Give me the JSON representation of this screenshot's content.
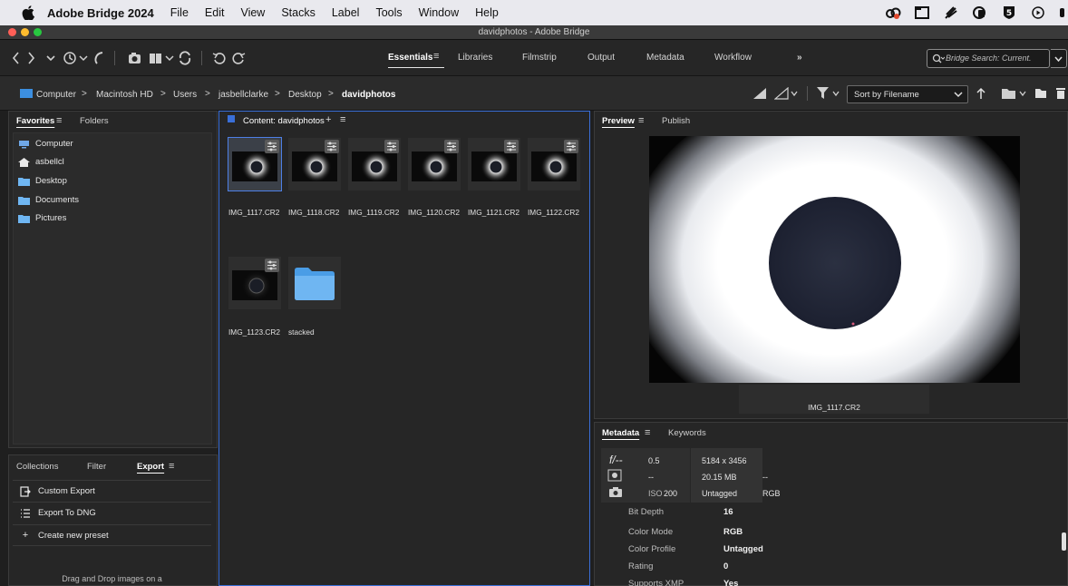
{
  "menubar": {
    "app_name": "Adobe Bridge 2024",
    "items": [
      "File",
      "Edit",
      "View",
      "Stacks",
      "Label",
      "Tools",
      "Window",
      "Help"
    ]
  },
  "window": {
    "title": "davidphotos - Adobe Bridge"
  },
  "workspaces": {
    "tabs": [
      "Essentials",
      "Libraries",
      "Filmstrip",
      "Output",
      "Metadata",
      "Workflow"
    ],
    "more": "»",
    "active": "Essentials"
  },
  "search": {
    "placeholder": "Bridge Search: Current."
  },
  "breadcrumb": [
    "Computer",
    "Macintosh HD",
    "Users",
    "jasbellclarke",
    "Desktop",
    "davidphotos"
  ],
  "breadcrumb_sep": ">",
  "sort": {
    "label": "Sort by Filename"
  },
  "favorites": {
    "tabs": [
      "Favorites",
      "Folders"
    ],
    "items": [
      "Computer",
      "asbellcl",
      "Desktop",
      "Documents",
      "Pictures"
    ]
  },
  "content": {
    "title": "Content: davidphotos",
    "items": [
      {
        "name": "IMG_1117.CR2",
        "type": "image"
      },
      {
        "name": "IMG_1118.CR2",
        "type": "image"
      },
      {
        "name": "IMG_1119.CR2",
        "type": "image"
      },
      {
        "name": "IMG_1120.CR2",
        "type": "image"
      },
      {
        "name": "IMG_1121.CR2",
        "type": "image"
      },
      {
        "name": "IMG_1122.CR2",
        "type": "image"
      },
      {
        "name": "IMG_1123.CR2",
        "type": "image"
      },
      {
        "name": "stacked",
        "type": "folder"
      }
    ]
  },
  "preview": {
    "tabs": [
      "Preview",
      "Publish"
    ],
    "caption": "IMG_1117.CR2"
  },
  "metadata": {
    "tabs": [
      "Metadata",
      "Keywords"
    ],
    "summary": {
      "aperture_icon": "f/--",
      "aperture": "0.5",
      "metering": "--",
      "iso_label": "ISO",
      "iso": "200",
      "dimensions": "5184 x 3456",
      "size": "20.15 MB",
      "size_extra": "--",
      "profile": "Untagged",
      "color": "RGB"
    },
    "rows": [
      {
        "label": "Bit Depth",
        "value": "16"
      },
      {
        "label": "Color Mode",
        "value": "RGB"
      },
      {
        "label": "Color Profile",
        "value": "Untagged"
      },
      {
        "label": "Rating",
        "value": "0"
      },
      {
        "label": "Supports XMP",
        "value": "Yes"
      }
    ]
  },
  "lower_left": {
    "tabs": [
      "Collections",
      "Filter",
      "Export"
    ],
    "items": [
      "Custom Export",
      "Export To DNG",
      "Create new preset"
    ],
    "hint": "Drag and Drop images on a"
  },
  "colors": {
    "accent": "#3a6fd8",
    "folder": "#6fb6f2",
    "menubar": "#e9e9ee"
  }
}
